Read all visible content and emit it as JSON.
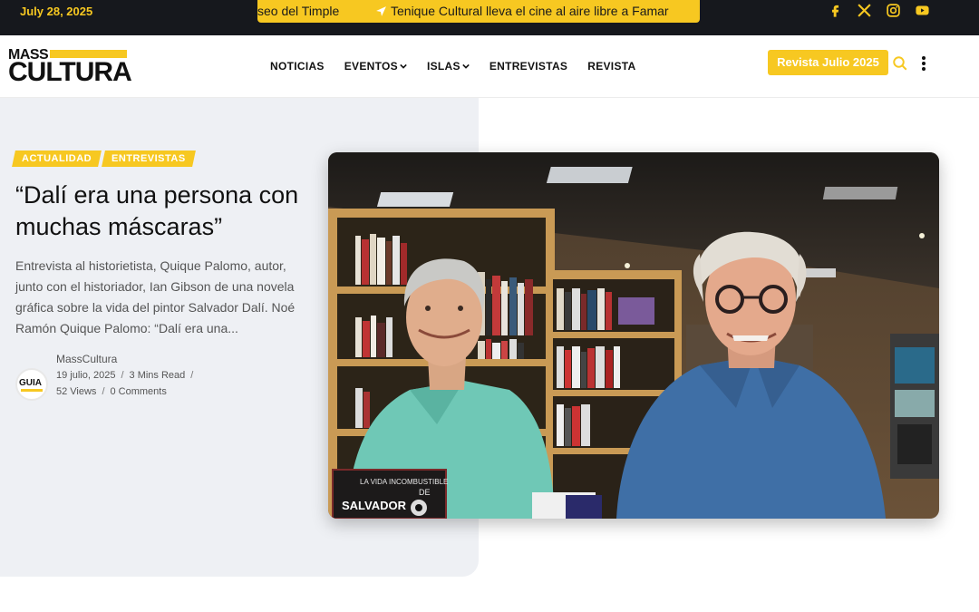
{
  "topbar": {
    "date": "July 28, 2025",
    "ticker_a": "seo del Timple",
    "ticker_b": "Tenique Cultural lleva el cine al aire libre a Famar",
    "socials": [
      "facebook-icon",
      "x-icon",
      "instagram-icon",
      "youtube-icon"
    ]
  },
  "header": {
    "logo_top": "MASS",
    "logo_bottom": "CULTURA",
    "nav": [
      "NOTICIAS",
      "EVENTOS",
      "ISLAS",
      "ENTREVISTAS",
      "REVISTA"
    ],
    "cta": "Revista Julio 2025"
  },
  "article": {
    "categories": [
      "ACTUALIDAD",
      "ENTREVISTAS"
    ],
    "title": "“Dalí era una persona con muchas máscaras”",
    "excerpt": "Entrevista al historietista, Quique Palomo, autor, junto con el historiador, Ian Gibson de una novela gráfica sobre la vida del pintor Salvador Dalí. Noé Ramón Quique Palomo: “Dalí era una...",
    "author_avatar_text": "GUIA",
    "author": "MassCultura",
    "date": "19 julio, 2025",
    "read_time": "3 Mins Read",
    "views": "52 Views",
    "comments": "0 Comments",
    "image_text_1": "LA VIDA INCOMBUSTIBLE",
    "image_text_2": "DE",
    "image_text_3": "SALVADOR"
  },
  "colors": {
    "accent": "#f7c821",
    "topbar": "#16181d",
    "hero_bg": "#eef0f4"
  }
}
